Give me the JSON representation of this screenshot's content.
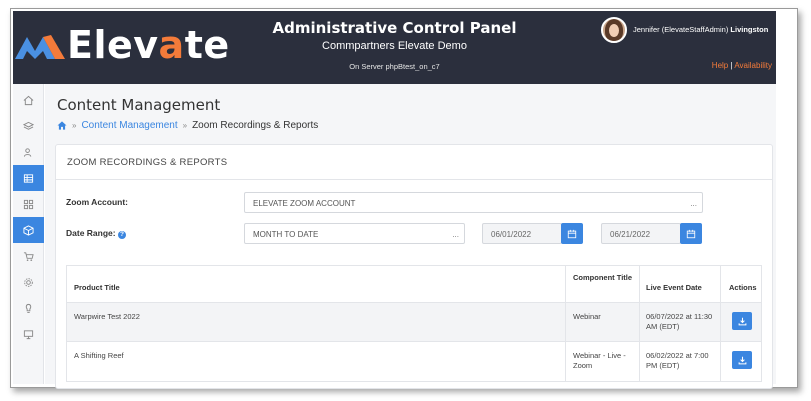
{
  "header": {
    "logo_text_1": "Elev",
    "logo_text_accent": "a",
    "logo_text_2": "te",
    "title": "Administrative Control Panel",
    "subtitle": "Commpartners Elevate Demo",
    "server": "On Server phpBtest_on_c7",
    "user_name": "Jennifer (ElevateStaffAdmin)",
    "user_last": "Livingston",
    "help_label": "Help",
    "separator": "|",
    "availability_label": "Availability",
    "accent_color": "#f47b3a"
  },
  "sidebar": {
    "items": [
      {
        "icon": "home-icon"
      },
      {
        "icon": "layers-icon"
      },
      {
        "icon": "users-icon"
      },
      {
        "icon": "table-icon",
        "active": true
      },
      {
        "icon": "grid-icon"
      },
      {
        "icon": "box-icon",
        "active": true
      },
      {
        "icon": "cart-icon"
      },
      {
        "icon": "gear-icon"
      },
      {
        "icon": "lightbulb-icon"
      },
      {
        "icon": "monitor-icon"
      }
    ]
  },
  "page": {
    "title": "Content Management",
    "breadcrumb_link": "Content Management",
    "breadcrumb_sep": "»",
    "breadcrumb_current": "Zoom Recordings & Reports"
  },
  "card": {
    "header": "ZOOM RECORDINGS & REPORTS",
    "zoom_account_label": "Zoom Account:",
    "zoom_account_value": "ELEVATE ZOOM ACCOUNT",
    "date_range_label": "Date Range:",
    "help_glyph": "?",
    "date_range_value": "MONTH TO DATE",
    "start_date": "06/01/2022",
    "end_date": "06/21/2022",
    "dots": "..."
  },
  "table": {
    "columns": [
      "Product Title",
      "Component Title",
      "Live Event Date",
      "Actions"
    ],
    "rows": [
      {
        "product": "Warpwire Test 2022",
        "component": "Webinar",
        "date": "06/07/2022 at 11:30 AM (EDT)"
      },
      {
        "product": "A Shifting Reef",
        "component": "Webinar - Live - Zoom",
        "date": "06/02/2022 at 7:00 PM (EDT)"
      }
    ]
  },
  "colors": {
    "header_bg": "#2b2f3d",
    "primary": "#3b86e0"
  }
}
